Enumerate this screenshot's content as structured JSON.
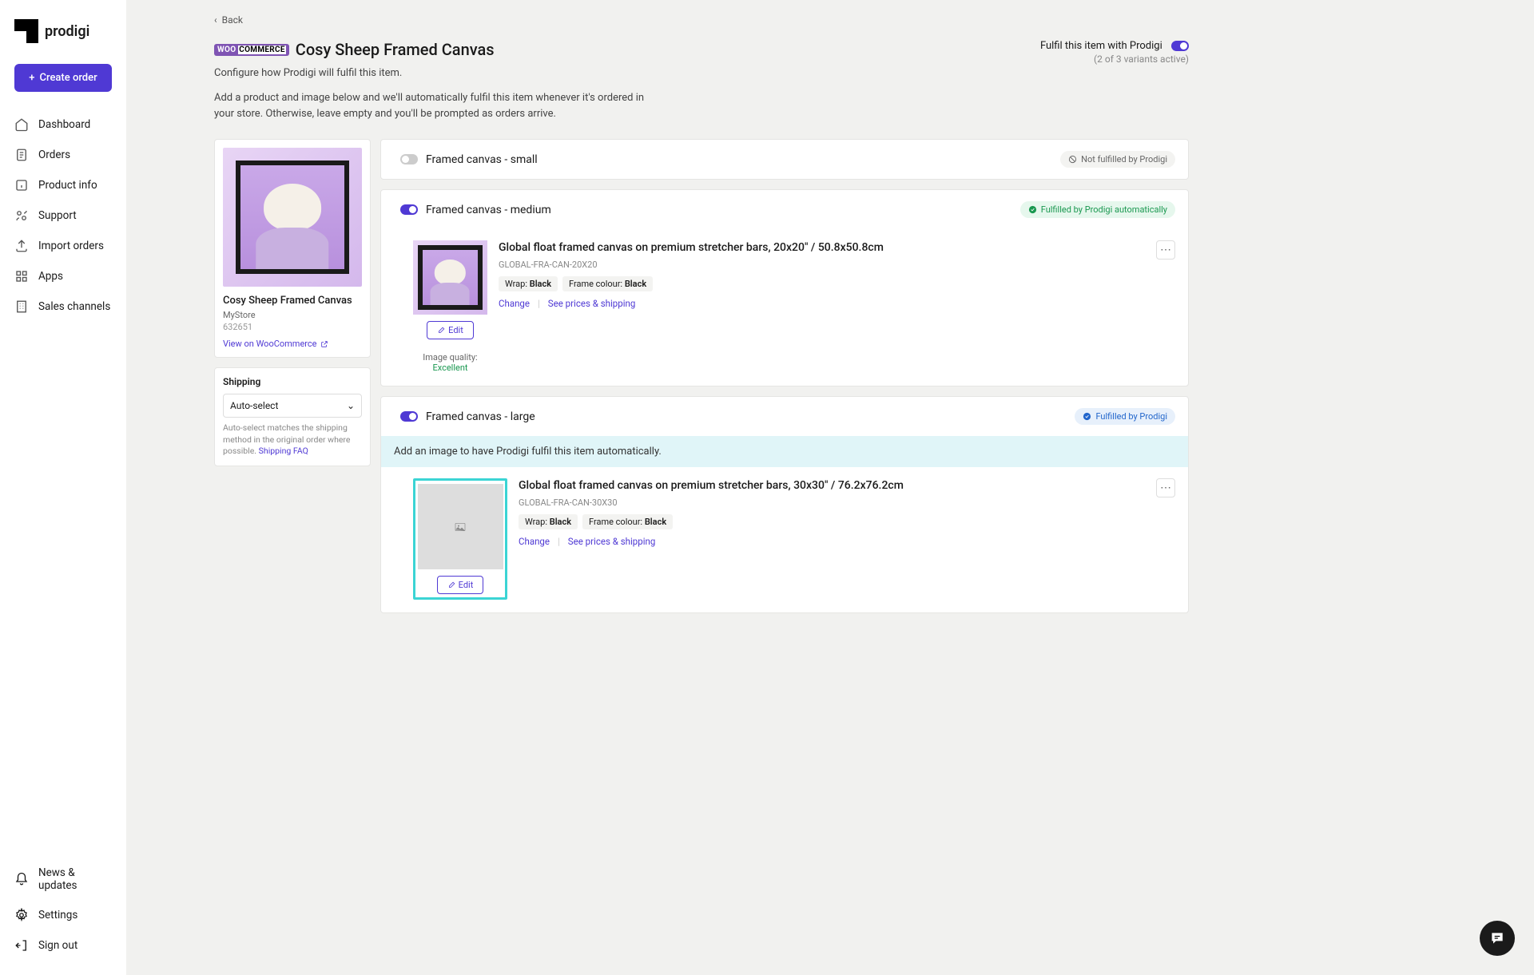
{
  "brand": "prodigi",
  "create_order": "Create order",
  "nav": {
    "dashboard": "Dashboard",
    "orders": "Orders",
    "product_info": "Product info",
    "support": "Support",
    "import_orders": "Import orders",
    "apps": "Apps",
    "sales_channels": "Sales channels",
    "news": "News & updates",
    "settings": "Settings",
    "signout": "Sign out"
  },
  "back": "Back",
  "platform_badge": "WOO COMMERCE",
  "title": "Cosy Sheep Framed Canvas",
  "subtitle": "Configure how Prodigi will fulfil this item.",
  "description": "Add a product and image below and we'll automatically fulfil this item whenever it's ordered in your store. Otherwise, leave empty and you'll be prompted as orders arrive.",
  "fulfil": {
    "label": "Fulfil this item with Prodigi",
    "sub": "(2 of 3 variants active)"
  },
  "product": {
    "name": "Cosy Sheep Framed Canvas",
    "store": "MyStore",
    "sku": "632651",
    "view_link": "View on WooCommerce"
  },
  "shipping": {
    "heading": "Shipping",
    "value": "Auto-select",
    "help": "Auto-select matches the shipping method in the original order where possible. ",
    "faq": "Shipping FAQ"
  },
  "badges": {
    "not_fulfilled": "Not fulfilled by Prodigi",
    "auto": "Fulfilled by Prodigi automatically",
    "manual": "Fulfilled by Prodigi"
  },
  "variants": {
    "small": {
      "name": "Framed canvas - small"
    },
    "medium": {
      "name": "Framed canvas - medium",
      "product_title": "Global float framed canvas on premium stretcher bars, 20x20\" / 50.8x50.8cm",
      "sku": "GLOBAL-FRA-CAN-20X20",
      "wrap_label": "Wrap: ",
      "wrap_value": "Black",
      "frame_label": "Frame colour: ",
      "frame_value": "Black",
      "change": "Change",
      "prices": "See prices & shipping",
      "edit": "Edit",
      "quality_label": "Image quality: ",
      "quality_value": "Excellent"
    },
    "large": {
      "name": "Framed canvas - large",
      "banner": "Add an image to have Prodigi fulfil this item automatically.",
      "product_title": "Global float framed canvas on premium stretcher bars, 30x30\" / 76.2x76.2cm",
      "sku": "GLOBAL-FRA-CAN-30X30",
      "wrap_label": "Wrap: ",
      "wrap_value": "Black",
      "frame_label": "Frame colour: ",
      "frame_value": "Black",
      "change": "Change",
      "prices": "See prices & shipping",
      "edit": "Edit"
    }
  }
}
